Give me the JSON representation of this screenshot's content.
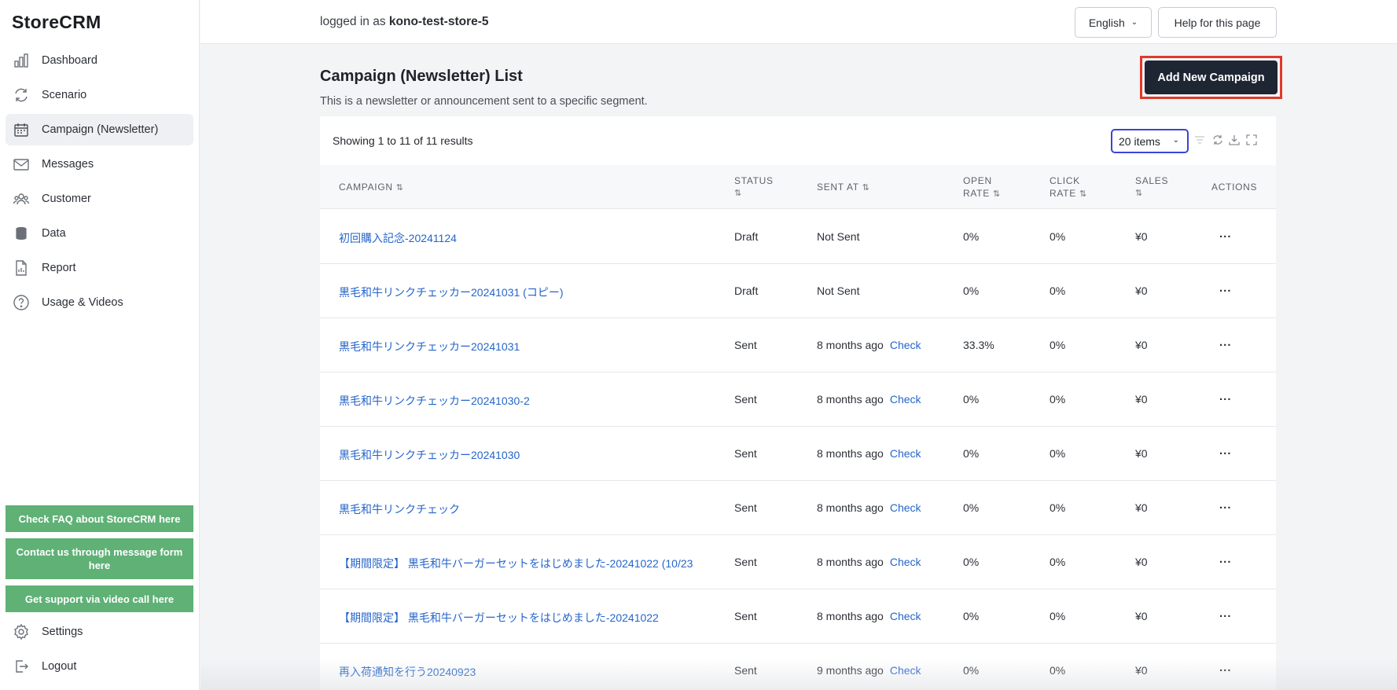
{
  "app": {
    "logo": "StoreCRM"
  },
  "sidebar": {
    "items": [
      {
        "label": "Dashboard",
        "icon": "bar-chart-icon",
        "active": false
      },
      {
        "label": "Scenario",
        "icon": "refresh-icon",
        "active": false
      },
      {
        "label": "Campaign (Newsletter)",
        "icon": "calendar-icon",
        "active": true
      },
      {
        "label": "Messages",
        "icon": "mail-icon",
        "active": false
      },
      {
        "label": "Customer",
        "icon": "users-icon",
        "active": false
      },
      {
        "label": "Data",
        "icon": "database-icon",
        "active": false
      },
      {
        "label": "Report",
        "icon": "document-icon",
        "active": false
      },
      {
        "label": "Usage & Videos",
        "icon": "help-circle-icon",
        "active": false
      }
    ],
    "support": {
      "faq": "Check FAQ about StoreCRM here",
      "contact": "Contact us through message form here",
      "video": "Get support via video call here"
    },
    "settings": "Settings",
    "logout": "Logout"
  },
  "topbar": {
    "login_prefix": "logged in as",
    "store": "kono-test-store-5",
    "language": "English",
    "help": "Help for this page"
  },
  "page": {
    "title": "Campaign (Newsletter) List",
    "description": "This is a newsletter or announcement sent to a specific segment.",
    "add_button": "Add New Campaign"
  },
  "table": {
    "showing": "Showing 1 to 11 of 11 results",
    "page_size": "20 items",
    "sort_glyph": "⇅",
    "columns": {
      "campaign": "CAMPAIGN",
      "status": "STATUS",
      "sent_at": "SENT AT",
      "open_rate_1": "OPEN",
      "open_rate_2": "RATE",
      "click_rate_1": "CLICK",
      "click_rate_2": "RATE",
      "sales": "SALES",
      "actions": "ACTIONS"
    },
    "actions_label": "...",
    "check_label": "Check",
    "rows": [
      {
        "campaign": "初回購入記念-20241124",
        "status": "Draft",
        "sent_at": "Not Sent",
        "check": false,
        "open_rate": "0%",
        "click_rate": "0%",
        "sales": "¥0"
      },
      {
        "campaign": "黒毛和牛リンクチェッカー20241031 (コピー)",
        "status": "Draft",
        "sent_at": "Not Sent",
        "check": false,
        "open_rate": "0%",
        "click_rate": "0%",
        "sales": "¥0"
      },
      {
        "campaign": "黒毛和牛リンクチェッカー20241031",
        "status": "Sent",
        "sent_at": "8 months ago",
        "check": true,
        "open_rate": "33.3%",
        "click_rate": "0%",
        "sales": "¥0"
      },
      {
        "campaign": "黒毛和牛リンクチェッカー20241030-2",
        "status": "Sent",
        "sent_at": "8 months ago",
        "check": true,
        "open_rate": "0%",
        "click_rate": "0%",
        "sales": "¥0"
      },
      {
        "campaign": "黒毛和牛リンクチェッカー20241030",
        "status": "Sent",
        "sent_at": "8 months ago",
        "check": true,
        "open_rate": "0%",
        "click_rate": "0%",
        "sales": "¥0"
      },
      {
        "campaign": "黒毛和牛リンクチェック",
        "status": "Sent",
        "sent_at": "8 months ago",
        "check": true,
        "open_rate": "0%",
        "click_rate": "0%",
        "sales": "¥0"
      },
      {
        "campaign": "【期間限定】 黒毛和牛バーガーセットをはじめました-20241022 (10/23",
        "status": "Sent",
        "sent_at": "8 months ago",
        "check": true,
        "open_rate": "0%",
        "click_rate": "0%",
        "sales": "¥0"
      },
      {
        "campaign": "【期間限定】 黒毛和牛バーガーセットをはじめました-20241022",
        "status": "Sent",
        "sent_at": "8 months ago",
        "check": true,
        "open_rate": "0%",
        "click_rate": "0%",
        "sales": "¥0"
      },
      {
        "campaign": "再入荷通知を行う20240923",
        "status": "Sent",
        "sent_at": "9 months ago",
        "check": true,
        "open_rate": "0%",
        "click_rate": "0%",
        "sales": "¥0"
      }
    ]
  },
  "colors": {
    "accent_link": "#2565c9",
    "support_green": "#5fb176",
    "primary_dark": "#1f2633",
    "highlight_red": "#e03a2a",
    "select_focus": "#3b44d6"
  }
}
